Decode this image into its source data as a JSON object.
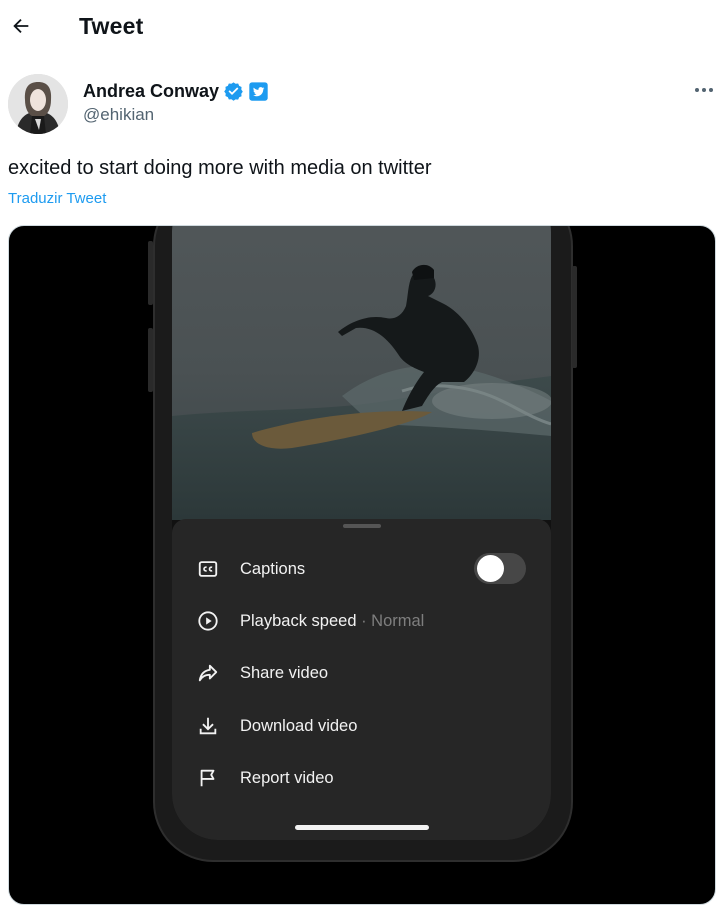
{
  "header": {
    "title": "Tweet"
  },
  "author": {
    "name": "Andrea Conway",
    "handle": "@ehikian"
  },
  "tweet": {
    "text": "excited to start doing more with media on twitter",
    "translate_label": "Traduzir Tweet"
  },
  "media_sheet": {
    "items": [
      {
        "label": "Captions",
        "icon": "closed-captions-icon",
        "toggle_on": false
      },
      {
        "label": "Playback speed",
        "sub": "· Normal",
        "icon": "play-circle-icon"
      },
      {
        "label": "Share video",
        "icon": "share-arrow-icon"
      },
      {
        "label": "Download video",
        "icon": "download-icon"
      },
      {
        "label": "Report video",
        "icon": "flag-icon"
      }
    ]
  },
  "colors": {
    "accent": "#1d9bf0",
    "verified": "#1d9bf0",
    "sheet_bg": "#262626",
    "media_bg": "#000000"
  }
}
